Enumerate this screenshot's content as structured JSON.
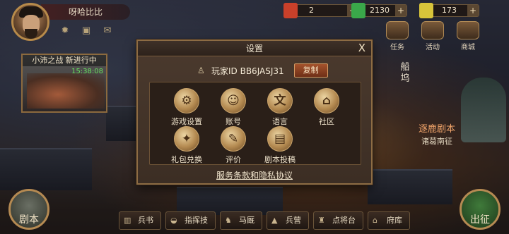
{
  "top": {
    "player_name": "呀哈比比",
    "resources": [
      {
        "value": "2",
        "color": "#c9402a"
      },
      {
        "value": "2130",
        "color": "#3aa84a"
      },
      {
        "value": "173",
        "color": "#d8c43a"
      }
    ],
    "plus_label": "+",
    "menu": [
      {
        "label": "任务"
      },
      {
        "label": "活动"
      },
      {
        "label": "商城"
      }
    ]
  },
  "event": {
    "title": "小沛之战 新进行中",
    "timer": "15:38:08"
  },
  "side": {
    "vertical_label": "船坞",
    "promo_title": "逐鹿剧本",
    "promo_sub": "诸葛南征"
  },
  "bottom": {
    "left_round": "剧本",
    "right_round": "出征",
    "buttons": [
      {
        "label": "兵书"
      },
      {
        "label": "指挥技"
      },
      {
        "label": "马厩"
      },
      {
        "label": "兵营"
      },
      {
        "label": "点将台"
      },
      {
        "label": "府库"
      }
    ]
  },
  "dialog": {
    "title": "设置",
    "close": "X",
    "player_id": "玩家ID BB6JASJ31",
    "copy_label": "复制",
    "options": [
      {
        "label": "游戏设置",
        "icon": "gear-icon",
        "glyph": "⚙"
      },
      {
        "label": "账号",
        "icon": "person-icon",
        "glyph": "☺"
      },
      {
        "label": "语言",
        "icon": "language-icon",
        "glyph": "文"
      },
      {
        "label": "社区",
        "icon": "community-icon",
        "glyph": "⌂"
      },
      {
        "label": "礼包兑换",
        "icon": "gift-bag-icon",
        "glyph": "✦"
      },
      {
        "label": "评价",
        "icon": "scroll-icon",
        "glyph": "✎"
      },
      {
        "label": "剧本投稿",
        "icon": "scroll-book-icon",
        "glyph": "▤"
      }
    ],
    "terms": "服务条款和隐私协议"
  }
}
